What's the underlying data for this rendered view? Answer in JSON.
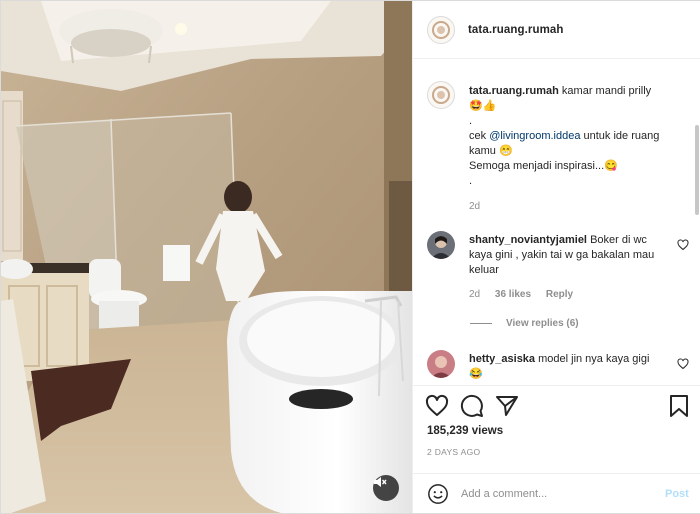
{
  "post": {
    "username": "tata.ruang.rumah",
    "media": {
      "type": "video",
      "mute_icon": "speaker-muted-icon"
    }
  },
  "caption": {
    "username": "tata.ruang.rumah",
    "line1": "kamar mandi prilly",
    "line1_emoji": "🤩👍",
    "dot1": ".",
    "line2_prefix": "cek",
    "line2_mention": "@livingroom.iddea",
    "line2_suffix": "untuk ide ruang kamu 😁",
    "line3": "Semoga menjadi inspirasi...😋",
    "dot2": ".",
    "time": "2d"
  },
  "comments": [
    {
      "username": "shanty_noviantyjamiel",
      "text": "Boker di wc kaya gini , yakin tai w ga bakalan mau keluar",
      "time": "2d",
      "likes": "36 likes",
      "reply_label": "Reply",
      "view_replies": "View replies (6)"
    },
    {
      "username": "hetty_asiska",
      "text": "model jin nya kaya gigi 😂"
    }
  ],
  "actions": {
    "like_icon": "heart-outline-icon",
    "comment_icon": "speech-bubble-icon",
    "share_icon": "paper-plane-icon",
    "save_icon": "bookmark-icon"
  },
  "stats": {
    "views": "185,239 views",
    "posted_ago": "2 DAYS AGO"
  },
  "composer": {
    "placeholder": "Add a comment...",
    "post_label": "Post",
    "emoji_icon": "smiley-face-icon"
  },
  "colors": {
    "link": "#00376b",
    "muted": "#8e8e8e",
    "post_disabled": "#b2dffc"
  }
}
